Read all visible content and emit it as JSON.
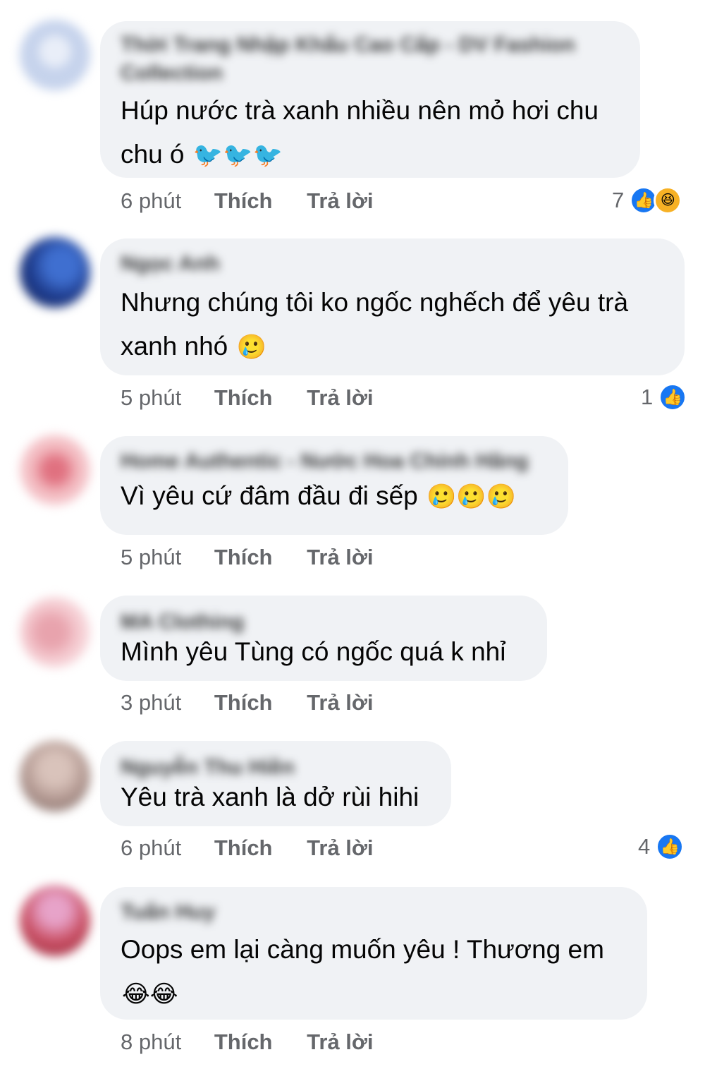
{
  "comments": [
    {
      "author": "Thời Trang Nhập Khẩu Cao Cấp - DV Fashion Collection",
      "text": "Húp nước trà xanh nhiều nên mỏ hơi chu chu ó",
      "emoji": "🐦🐦🐦",
      "time": "6 phút",
      "like_label": "Thích",
      "reply_label": "Trả lời",
      "reactions": {
        "count": "7",
        "types": [
          "like",
          "haha"
        ]
      },
      "avatar_color": "#c6d3ec"
    },
    {
      "author": "Ngọc Anh",
      "text": "Nhưng chúng tôi ko ngốc nghếch để yêu trà xanh nhó",
      "emoji": "🥲",
      "time": "5 phút",
      "like_label": "Thích",
      "reply_label": "Trả lời",
      "reactions": {
        "count": "1",
        "types": [
          "like"
        ]
      },
      "avatar_color": "#2c4fa8"
    },
    {
      "author": "Home Authentic - Nước Hoa Chính Hãng",
      "text": "Vì yêu cứ đâm đầu đi sếp",
      "emoji": "🥲🥲🥲",
      "time": "5 phút",
      "like_label": "Thích",
      "reply_label": "Trả lời",
      "reactions": null,
      "avatar_color": "#f2b8be"
    },
    {
      "author": "MA Clothing",
      "text": "Mình yêu Tùng có ngốc quá k nhỉ",
      "emoji": "",
      "time": "3 phút",
      "like_label": "Thích",
      "reply_label": "Trả lời",
      "reactions": null,
      "avatar_color": "#f4c9cf"
    },
    {
      "author": "Nguyễn Thu Hiền",
      "text": "Yêu trà xanh là dở rùi hihi",
      "emoji": "",
      "time": "6 phút",
      "like_label": "Thích",
      "reply_label": "Trả lời",
      "reactions": {
        "count": "4",
        "types": [
          "like"
        ]
      },
      "avatar_color": "#b49a93"
    },
    {
      "author": "Tuấn Huy",
      "text": "Oops em lại càng muốn yêu ! Thương em",
      "emoji": "😂😂",
      "time": "8 phút",
      "like_label": "Thích",
      "reply_label": "Trả lời",
      "reactions": null,
      "avatar_color": "#c94f63"
    }
  ],
  "reaction_icons": {
    "like": "thumbs-up-icon",
    "haha": "laughing-face-icon"
  },
  "colors": {
    "bubble": "#f0f2f5",
    "meta_text": "#65676b",
    "like_blue": "#1877f2",
    "haha_yellow": "#f7b125"
  }
}
